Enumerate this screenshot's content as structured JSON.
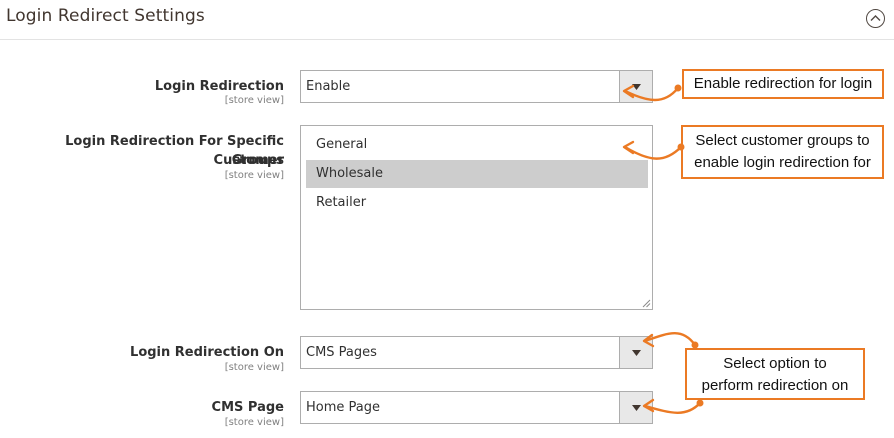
{
  "section": {
    "title": "Login Redirect Settings",
    "collapse_icon": "chevron-up-circle-icon"
  },
  "fields": {
    "login_redirection": {
      "label": "Login Redirection",
      "scope": "[store view]",
      "value": "Enable"
    },
    "customer_groups": {
      "label_line1": "Login Redirection For Specific Customer",
      "label_line2": "Groups",
      "scope": "[store view]",
      "options": [
        "General",
        "Wholesale",
        "Retailer"
      ],
      "selected": "Wholesale"
    },
    "redirection_on": {
      "label": "Login Redirection On",
      "scope": "[store view]",
      "value": "CMS Pages"
    },
    "cms_page": {
      "label": "CMS Page",
      "scope": "[store view]",
      "value": "Home Page"
    }
  },
  "callouts": {
    "login": "Enable redirection for login",
    "groups_line1": "Select customer groups to",
    "groups_line2": "enable login redirection for",
    "option_line1": "Select option to",
    "option_line2": "perform redirection on"
  },
  "colors": {
    "accent_orange": "#eb7a24",
    "selected_option_bg": "#cdcdcd",
    "field_border": "#adadad"
  }
}
